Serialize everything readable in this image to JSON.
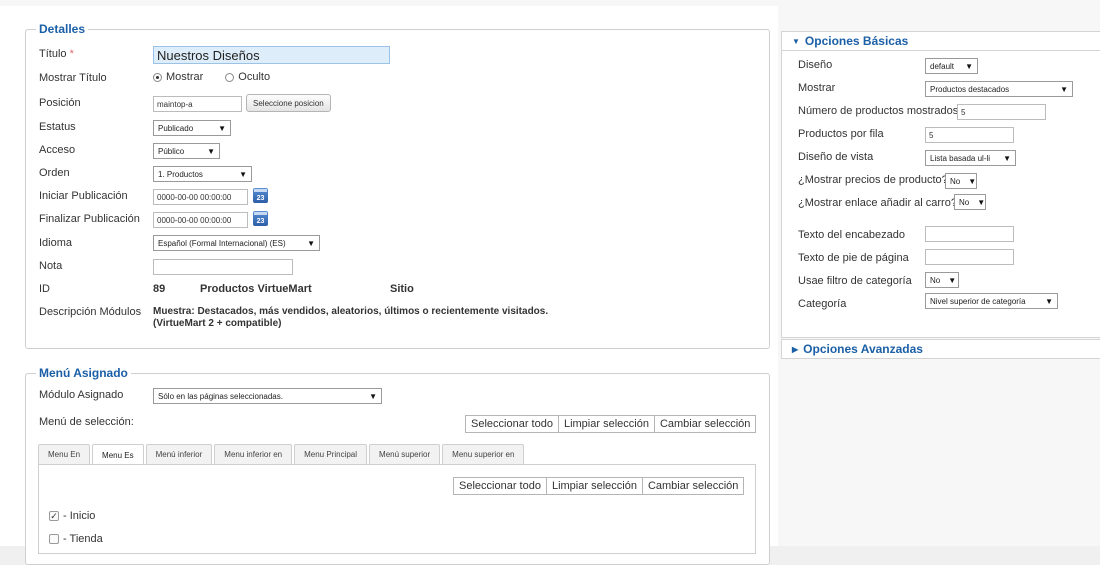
{
  "detalles": {
    "legend": "Detalles",
    "titulo_label": "Título",
    "required_mark": "*",
    "titulo_value": "Nuestros Diseños",
    "mostrar_titulo_label": "Mostrar Título",
    "mostrar_opt": "Mostrar",
    "oculto_opt": "Oculto",
    "posicion_label": "Posición",
    "posicion_value": "maintop-a",
    "posicion_button": "Seleccione posicion",
    "estatus_label": "Estatus",
    "estatus_value": "Publicado",
    "acceso_label": "Acceso",
    "acceso_value": "Público",
    "orden_label": "Orden",
    "orden_value": "1. Productos",
    "iniciar_label": "Iniciar Publicación",
    "iniciar_value": "0000-00-00 00:00:00",
    "finalizar_label": "Finalizar Publicación",
    "finalizar_value": "0000-00-00 00:00:00",
    "calendar_day": "23",
    "idioma_label": "Idioma",
    "idioma_value": "Español (Formal Internacional) (ES)",
    "nota_label": "Nota",
    "nota_value": "",
    "id_label": "ID",
    "id_value": "89",
    "id_module": "Productos VirtueMart",
    "id_site": "Sitio",
    "desc_label": "Descripción Módulos",
    "desc_line1": "Muestra: Destacados, más vendidos, aleatorios, últimos o recientemente visitados.",
    "desc_line2": "(VirtueMart 2 + compatible)"
  },
  "menu_asignado": {
    "legend": "Menú Asignado",
    "modulo_label": "Módulo Asignado",
    "modulo_value": "Sólo en las páginas seleccionadas.",
    "seleccion_label": "Menú de selección:",
    "buttons": [
      "Seleccionar todo",
      "Limpiar selección",
      "Cambiar selección"
    ],
    "tabs": [
      "Menu En",
      "Menu Es",
      "Menú inferior",
      "Menu inferior en",
      "Menu Principal",
      "Menú superior",
      "Menu superior en"
    ],
    "active_tab": "Menu Es",
    "items": [
      {
        "label": "- Inicio",
        "checked": true,
        "mark": "✓"
      },
      {
        "label": "- Tienda",
        "checked": false,
        "mark": ""
      }
    ]
  },
  "opciones_basicas": {
    "title": "Opciones Básicas",
    "diseno_label": "Diseño",
    "diseno_value": "default",
    "mostrar_label": "Mostrar",
    "mostrar_value": "Productos destacados",
    "numero_label": "Número de productos mostrados",
    "numero_value": "5",
    "por_fila_label": "Productos por fila",
    "por_fila_value": "5",
    "vista_label": "Diseño de vista",
    "vista_value": "Lista basada ul-li",
    "precios_label": "¿Mostrar precios de producto?",
    "precios_value": "No",
    "carro_label": "¿Mostrar enlace añadir al carro?",
    "carro_value": "No",
    "encabezado_label": "Texto del encabezado",
    "pie_label": "Texto de pie de página",
    "filtro_label": "Usae filtro de categoría",
    "filtro_value": "No",
    "categoria_label": "Categoría",
    "categoria_value": "Nivel superior de categoría"
  },
  "opciones_avanzadas": {
    "title": "Opciones Avanzadas"
  },
  "icons": {
    "dropdown": "▼",
    "expanded": "▼",
    "collapsed": "▶"
  },
  "colors": {
    "accent": "#1b5fa6",
    "title_field": "#ddeefa",
    "required": "#e06a6a"
  }
}
